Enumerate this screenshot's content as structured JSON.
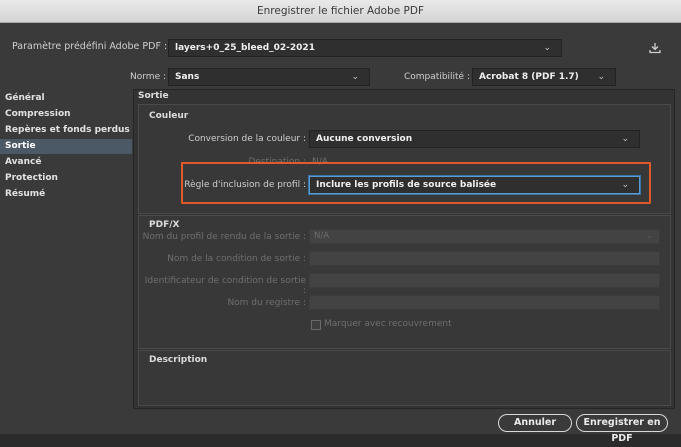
{
  "window": {
    "title": "Enregistrer le fichier Adobe PDF"
  },
  "preset": {
    "label": "Paramètre prédéfini Adobe PDF :",
    "value": "layers+0_25_bleed_02-2021"
  },
  "norme": {
    "label": "Norme :",
    "value": "Sans"
  },
  "compat": {
    "label": "Compatibilité :",
    "value": "Acrobat 8 (PDF 1.7)"
  },
  "sidebar": {
    "items": [
      {
        "label": "Général"
      },
      {
        "label": "Compression"
      },
      {
        "label": "Repères et fonds perdus"
      },
      {
        "label": "Sortie"
      },
      {
        "label": "Avancé"
      },
      {
        "label": "Protection"
      },
      {
        "label": "Résumé"
      }
    ],
    "active_index": 3
  },
  "panel": {
    "title": "Sortie"
  },
  "couleur": {
    "title": "Couleur",
    "conversion_label": "Conversion de la couleur :",
    "conversion_value": "Aucune conversion",
    "destination_label": "Destination :",
    "destination_value": "N/A",
    "regle_label": "Règle d'inclusion de profil :",
    "regle_value": "Inclure les profils de source balisée"
  },
  "pdfx": {
    "title": "PDF/X",
    "profil_label": "Nom du profil de rendu de la sortie :",
    "profil_value": "N/A",
    "condition_label": "Nom de la condition de sortie :",
    "identificateur_label": "Identificateur de condition de sortie :",
    "registre_label": "Nom du registre :",
    "marquer_label": "Marquer avec recouvrement"
  },
  "description": {
    "title": "Description"
  },
  "buttons": {
    "annuler": "Annuler",
    "enregistrer": "Enregistrer en PDF"
  },
  "colors": {
    "highlight": "#e05a2a",
    "active_item": "#4b5865",
    "focus": "#5d9bd5"
  },
  "icons": {
    "download": "download-icon",
    "chevron": "chevron-down-icon"
  }
}
